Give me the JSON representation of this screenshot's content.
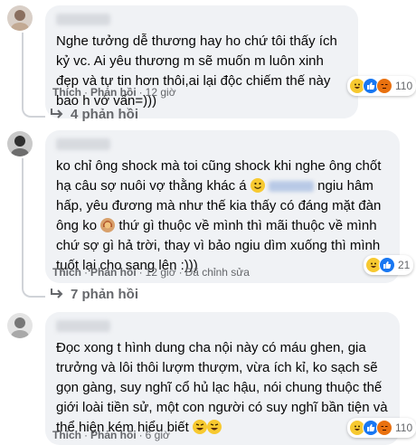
{
  "comments": [
    {
      "text": "Nghe tưởng dễ thương hay ho chứ tôi thấy ích kỷ vc. Ai yêu thương m sẽ muốn m luôn xinh đẹp và tự tin hơn thôi,ai lại độc chiếm thế này bao h vớ vẩn=)))",
      "like_label": "Thích",
      "reply_label": "Phản hồi",
      "time": "12 giờ",
      "edited": "",
      "reaction_count": "110",
      "replies_label": "4 phản hồi"
    },
    {
      "text_a": "ko chỉ ông shock mà toi cũng shock khi nghe ông chốt hạ câu sợ nuôi vợ thằng khác á",
      "text_b": "ngiu hâm hấp, yêu đương mà như thế kia thấy có đáng mặt đàn ông ko",
      "text_c": "thứ gì thuộc về mình thì mãi thuộc về mình chứ sợ gì hả trời, thay vì bảo ngiu dìm xuống thì mình tuốt lại cho sang lên :)))",
      "like_label": "Thích",
      "reply_label": "Phản hồi",
      "time": "12 giờ",
      "edited": "Đã chỉnh sửa",
      "reaction_count": "21",
      "replies_label": "7 phản hồi"
    },
    {
      "text": "Đọc xong t hình dung cha nội này có máu ghen, gia trưởng và lôi thôi lượm thượm, vừa ích kỉ, ko sạch sẽ gọn gàng, suy nghĩ cổ hủ lạc hậu, nói chung thuộc thế giới loài tiền sử, một con người có suy nghĩ bần tiện và thể hiện kém hiểu biết",
      "like_label": "Thích",
      "reply_label": "Phản hồi",
      "time": "6 giờ",
      "reaction_count": "110"
    }
  ],
  "colors": {
    "like": "#1877f2",
    "haha": "#f7c930",
    "angry": "#e9710f"
  },
  "icons": [
    "reply-arrow-icon",
    "like-icon",
    "haha-icon",
    "angry-icon",
    "smile-emoji-icon",
    "woman-shrug-emoji-icon",
    "rolling-laugh-emoji-icon"
  ]
}
